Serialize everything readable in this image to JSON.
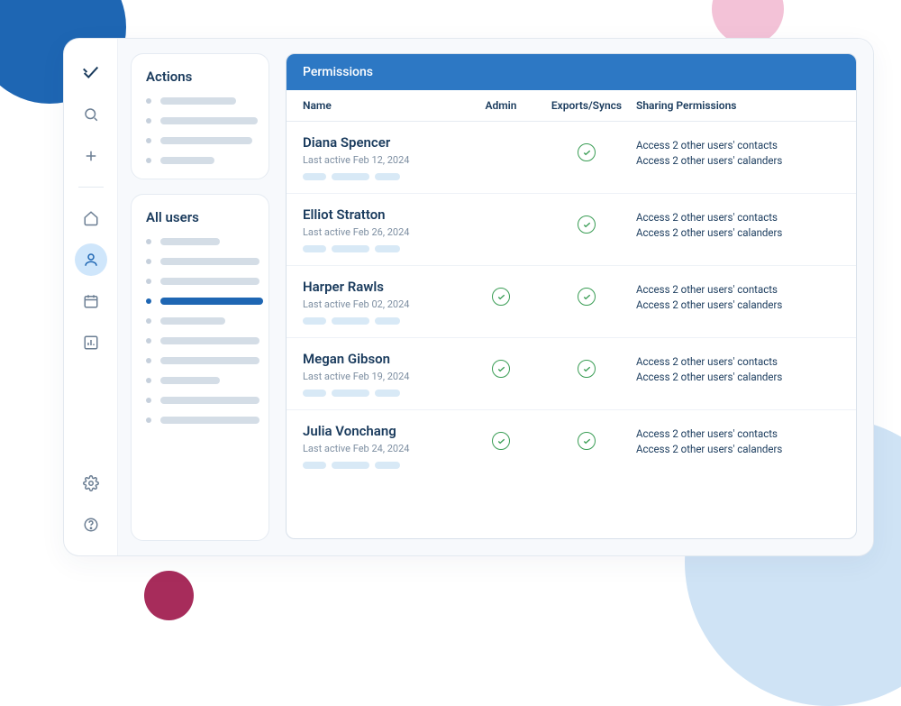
{
  "sidebar": {
    "actions_title": "Actions",
    "allusers_title": "All users"
  },
  "panel": {
    "title": "Permissions",
    "columns": {
      "name": "Name",
      "admin": "Admin",
      "exports": "Exports/Syncs",
      "sharing": "Sharing Permissions"
    }
  },
  "users": [
    {
      "name": "Diana Spencer",
      "last_active": "Last active Feb 12, 2024",
      "admin": false,
      "exports": true,
      "sharing1": "Access 2 other users' contacts",
      "sharing2": "Access 2 other users' calanders"
    },
    {
      "name": "Elliot Stratton",
      "last_active": "Last active Feb 26, 2024",
      "admin": false,
      "exports": true,
      "sharing1": "Access 2 other users' contacts",
      "sharing2": "Access 2 other users' calanders"
    },
    {
      "name": "Harper Rawls",
      "last_active": "Last active Feb 02, 2024",
      "admin": true,
      "exports": true,
      "sharing1": "Access 2 other users' contacts",
      "sharing2": "Access 2 other users' calanders"
    },
    {
      "name": "Megan Gibson",
      "last_active": "Last active Feb 19, 2024",
      "admin": true,
      "exports": true,
      "sharing1": "Access 2 other users' contacts",
      "sharing2": "Access 2 other users' calanders"
    },
    {
      "name": "Julia Vonchang",
      "last_active": "Last active Feb 24, 2024",
      "admin": true,
      "exports": true,
      "sharing1": "Access 2 other users' contacts",
      "sharing2": "Access 2 other users' calanders"
    }
  ]
}
